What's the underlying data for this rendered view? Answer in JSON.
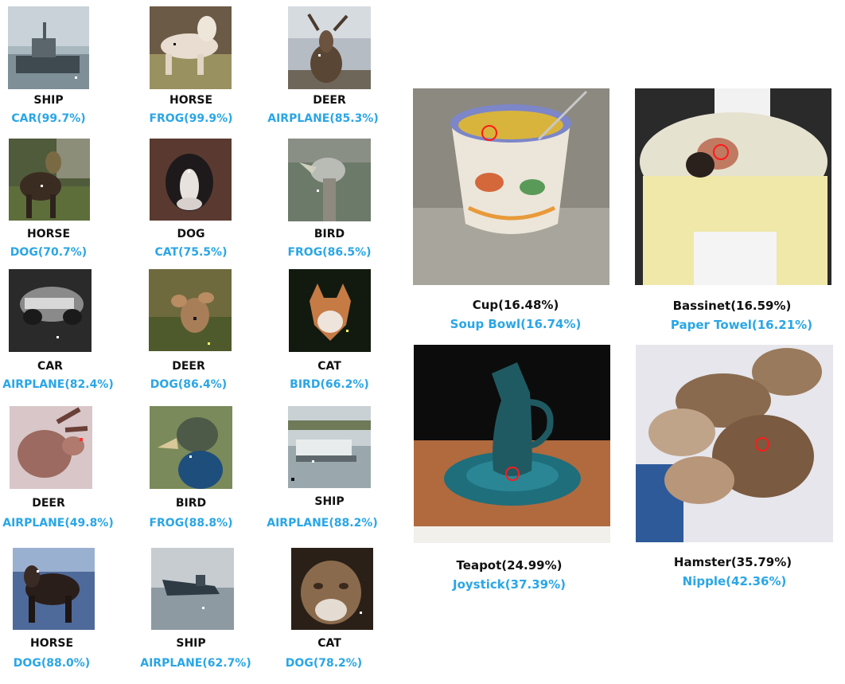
{
  "colors": {
    "true_label": "#111111",
    "adversarial_label": "#2aa6e6",
    "marker": "#ff1a1a"
  },
  "cifar": [
    {
      "true": "SHIP",
      "adv": "CAR(99.7%)"
    },
    {
      "true": "HORSE",
      "adv": "FROG(99.9%)"
    },
    {
      "true": "DEER",
      "adv": "AIRPLANE(85.3%)"
    },
    {
      "true": "HORSE",
      "adv": "DOG(70.7%)"
    },
    {
      "true": "DOG",
      "adv": "CAT(75.5%)"
    },
    {
      "true": "BIRD",
      "adv": "FROG(86.5%)"
    },
    {
      "true": "CAR",
      "adv": "AIRPLANE(82.4%)"
    },
    {
      "true": "DEER",
      "adv": "DOG(86.4%)"
    },
    {
      "true": "CAT",
      "adv": "BIRD(66.2%)"
    },
    {
      "true": "DEER",
      "adv": "AIRPLANE(49.8%)"
    },
    {
      "true": "BIRD",
      "adv": "FROG(88.8%)"
    },
    {
      "true": "SHIP",
      "adv": "AIRPLANE(88.2%)"
    },
    {
      "true": "HORSE",
      "adv": "DOG(88.0%)"
    },
    {
      "true": "SHIP",
      "adv": "AIRPLANE(62.7%)"
    },
    {
      "true": "CAT",
      "adv": "DOG(78.2%)"
    }
  ],
  "imagenet": [
    {
      "true": "Cup(16.48%)",
      "adv": "Soup Bowl(16.74%)"
    },
    {
      "true": "Bassinet(16.59%)",
      "adv": "Paper Towel(16.21%)"
    },
    {
      "true": "Teapot(24.99%)",
      "adv": "Joystick(37.39%)"
    },
    {
      "true": "Hamster(35.79%)",
      "adv": "Nipple(42.36%)"
    }
  ]
}
